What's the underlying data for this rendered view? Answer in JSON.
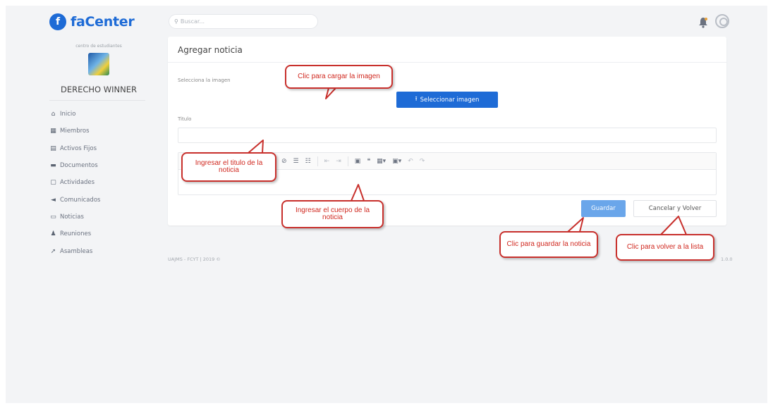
{
  "brand": {
    "logo_letter": "f",
    "name": "faCenter",
    "color": "#1e6bd6"
  },
  "org": {
    "subtitle": "centro de estudiantes",
    "name": "DERECHO WINNER"
  },
  "nav": [
    {
      "icon": "home-icon",
      "glyph": "⌂",
      "label": "Inicio"
    },
    {
      "icon": "members-icon",
      "glyph": "▦",
      "label": "Miembros"
    },
    {
      "icon": "assets-icon",
      "glyph": "▤",
      "label": "Activos Fijos"
    },
    {
      "icon": "folder-icon",
      "glyph": "▬",
      "label": "Documentos"
    },
    {
      "icon": "activities-icon",
      "glyph": "▢",
      "label": "Actividades"
    },
    {
      "icon": "megaphone-icon",
      "glyph": "◄",
      "label": "Comunicados"
    },
    {
      "icon": "news-icon",
      "glyph": "▭",
      "label": "Noticias"
    },
    {
      "icon": "meetings-icon",
      "glyph": "♟",
      "label": "Reuniones"
    },
    {
      "icon": "assemblies-icon",
      "glyph": "➚",
      "label": "Asambleas"
    }
  ],
  "search": {
    "placeholder": "Buscar..."
  },
  "card": {
    "title": "Agregar noticia",
    "image_label": "Selecciona la imagen",
    "upload_button": "Seleccionar imagen",
    "title_label": "Titulo",
    "title_value": "",
    "save_button": "Guardar",
    "cancel_button": "Cancelar y Volver"
  },
  "footer": {
    "left": "UAJMS - FCYT | 2019 ©",
    "right": "1.0.0"
  },
  "callouts": {
    "upload": "Clic para cargar la imagen",
    "title": "Ingresar el titulo de la noticia",
    "body": "Ingresar el cuerpo de la noticia",
    "save": "Clic para guardar la noticia",
    "back": "Clic para volver a la lista"
  },
  "colors": {
    "primary": "#1e6bd6",
    "save": "#6aa6ea",
    "callout": "#c8302c",
    "background": "#f3f4f6"
  }
}
